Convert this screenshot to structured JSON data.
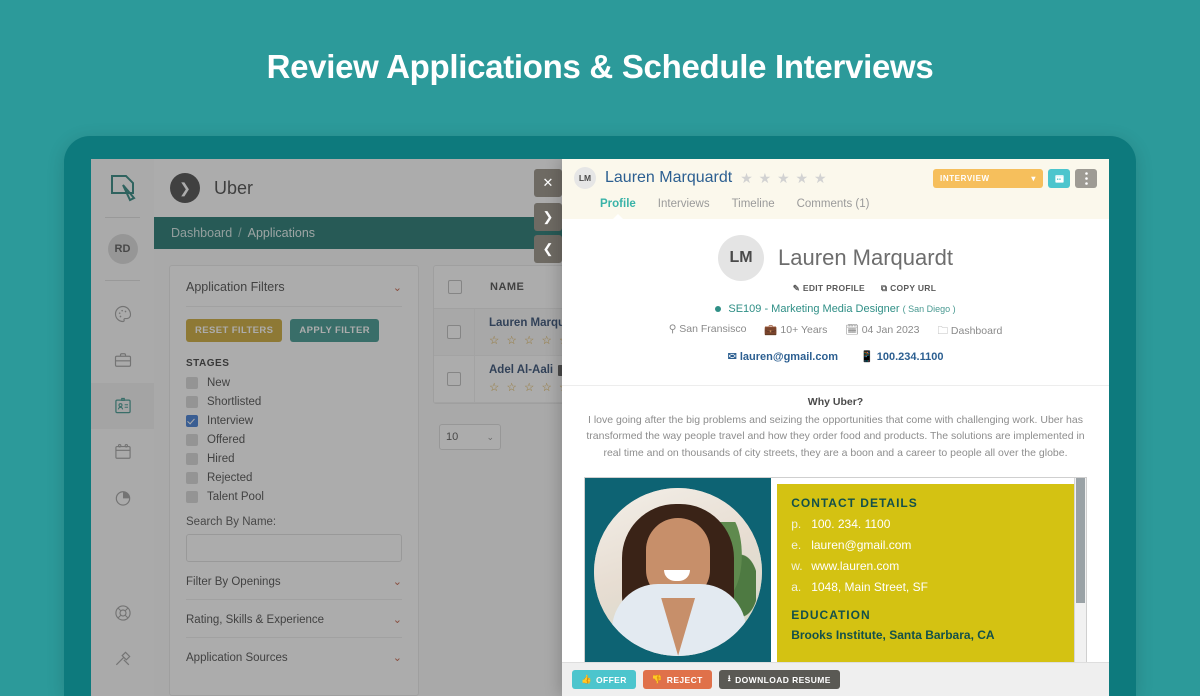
{
  "banner": {
    "title": "Review Applications & Schedule Interviews"
  },
  "colors": {
    "background_teal": "#2c9a9a",
    "device_frame": "#0d7a7d",
    "breadcrumb_bar": "#0d6b63",
    "accent_teal": "#2f8f86",
    "reset_gold": "#c9a227",
    "stage_amber": "#f6bf5c",
    "offer_cyan": "#4cc5cd",
    "reject_orange": "#e0714a",
    "star_gold": "#d8a22a",
    "link_blue": "#2c5f91"
  },
  "rail": {
    "logo_icon": "document-pen-logo-icon",
    "avatar_initials": "RD",
    "items": [
      {
        "icon": "palette-icon",
        "name": "palette",
        "active": false
      },
      {
        "icon": "briefcase-icon",
        "name": "jobs",
        "active": false
      },
      {
        "icon": "id-card-icon",
        "name": "applications",
        "active": true
      },
      {
        "icon": "calendar-icon",
        "name": "calendar",
        "active": false
      },
      {
        "icon": "pie-chart-icon",
        "name": "reports",
        "active": false
      }
    ],
    "bottom_items": [
      {
        "icon": "lifebuoy-icon",
        "name": "support"
      },
      {
        "icon": "tools-icon",
        "name": "settings"
      }
    ]
  },
  "topbar": {
    "back_icon": "chevron-right-icon",
    "title": "Uber"
  },
  "breadcrumb": {
    "root": "Dashboard",
    "separator": "/",
    "current": "Applications"
  },
  "side_controls": {
    "close_label": "✕",
    "next_label": "❯",
    "prev_label": "❮"
  },
  "filters": {
    "heading": "Application Filters",
    "collapse_icon": "chevron-down-icon",
    "reset_label": "RESET FILTERS",
    "apply_label": "APPLY FILTER",
    "stages_title": "STAGES",
    "stages": [
      {
        "label": "New",
        "checked": false
      },
      {
        "label": "Shortlisted",
        "checked": false
      },
      {
        "label": "Interview",
        "checked": true
      },
      {
        "label": "Offered",
        "checked": false
      },
      {
        "label": "Hired",
        "checked": false
      },
      {
        "label": "Rejected",
        "checked": false
      },
      {
        "label": "Talent Pool",
        "checked": false
      }
    ],
    "search_label": "Search By Name:",
    "search_value": "",
    "search_placeholder": "",
    "accordions": [
      "Filter By Openings",
      "Rating, Skills & Experience",
      "Application Sources"
    ]
  },
  "table": {
    "column_name": "NAME",
    "rows": [
      {
        "name": "Lauren Marquardt",
        "stars": "☆ ☆ ☆ ☆ ☆",
        "has_resume": true
      },
      {
        "name": "Adel Al-Aali",
        "stars": "☆ ☆ ☆ ☆ ☆",
        "has_resume": true
      }
    ],
    "per_page": "10",
    "per_page_icon": "chevron-down-icon"
  },
  "modal": {
    "header": {
      "badge": "LM",
      "name": "Lauren Marquardt",
      "stars": "★ ★ ★ ★ ★",
      "stage_label": "INTERVIEW",
      "stage_caret": "▾",
      "calendar_icon": "calendar-icon",
      "more_icon": "vertical-dots-icon"
    },
    "tabs": [
      {
        "label": "Profile",
        "active": true
      },
      {
        "label": "Interviews",
        "active": false
      },
      {
        "label": "Timeline",
        "active": false
      },
      {
        "label": "Comments (1)",
        "active": false
      }
    ],
    "profile": {
      "avatar_initials": "LM",
      "name": "Lauren Marquardt",
      "edit_label": "EDIT PROFILE",
      "edit_icon": "pencil-square-icon",
      "copy_label": "COPY URL",
      "copy_icon": "copy-icon",
      "role": "SE109 - Marketing Media Designer",
      "role_location": "( San Diego )",
      "meta": [
        {
          "icon": "map-pin-icon",
          "text": "San Fransisco"
        },
        {
          "icon": "briefcase-icon",
          "text": "10+ Years"
        },
        {
          "icon": "calendar-icon",
          "text": "04 Jan 2023"
        },
        {
          "icon": "folder-icon",
          "text": "Dashboard"
        }
      ],
      "email_icon": "envelope-icon",
      "email": "lauren@gmail.com",
      "phone_icon": "mobile-icon",
      "phone": "100.234.1100"
    },
    "why": {
      "title": "Why Uber?",
      "body": "I love going after the big problems and seizing the opportunities that come with challenging work. Uber has transformed the way people travel and how they order food and products. The solutions are implemented in real time and on thousands of city streets, they are a boon and a career to people all over the globe."
    },
    "resume": {
      "contact_heading": "CONTACT DETAILS",
      "lines": [
        {
          "key": "p.",
          "value": "100. 234. 1100"
        },
        {
          "key": "e.",
          "value": "lauren@gmail.com"
        },
        {
          "key": "w.",
          "value": "www.lauren.com"
        },
        {
          "key": "a.",
          "value": "1048, Main Street, SF"
        }
      ],
      "education_heading": "EDUCATION",
      "education_line": "Brooks Institute, Santa Barbara, CA"
    },
    "footer": {
      "offer_label": "OFFER",
      "offer_icon": "thumbs-up-icon",
      "reject_label": "REJECT",
      "reject_icon": "thumbs-down-icon",
      "download_label": "DOWNLOAD RESUME",
      "download_icon": "download-icon"
    }
  }
}
